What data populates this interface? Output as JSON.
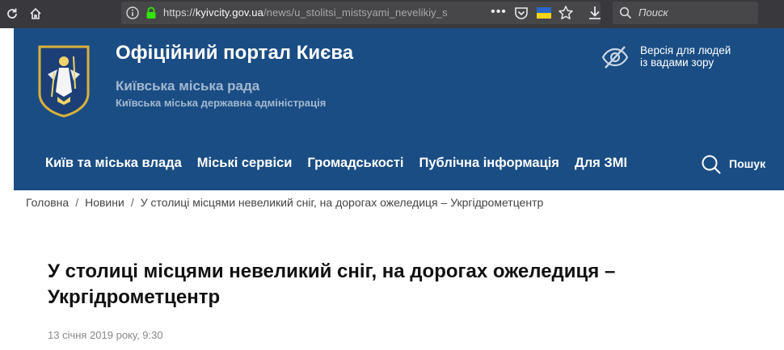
{
  "browser": {
    "url_host": "kyivcity.gov.ua",
    "url_prefix": "https://",
    "url_path": "/news/u_stolitsi_mistsyami_nevelikiy_s",
    "search_placeholder": "Поиск",
    "more_label": "•••",
    "icons": [
      "reload-icon",
      "home-icon",
      "info-icon",
      "lock-icon",
      "page-actions-icon",
      "pocket-icon",
      "flag-icon",
      "bookmark-star-icon",
      "download-icon",
      "search-icon"
    ]
  },
  "header": {
    "title": "Офіційний портал Києва",
    "subtitle1": "Київська міська рада",
    "subtitle2": "Київська міська державна адміністрація",
    "accessibility_line1": "Версія для людей",
    "accessibility_line2": "із вадами зору",
    "bg_color": "#1a4d84"
  },
  "nav": {
    "items": [
      {
        "label": "Київ та міська влада"
      },
      {
        "label": "Міські сервіси"
      },
      {
        "label": "Громадськості"
      },
      {
        "label": "Публічна інформація"
      },
      {
        "label": "Для ЗМІ"
      }
    ],
    "search_label": "Пошук"
  },
  "breadcrumb": {
    "home": "Головна",
    "news": "Новини",
    "current": "У столиці місцями невеликий сніг, на дорогах ожеледиця – Укргідрометцентр",
    "separator": "/"
  },
  "article": {
    "title": "У столиці місцями невеликий сніг, на дорогах ожеледиця – Укргідрометцентр",
    "date": "13 січня 2019 року, 9:30"
  }
}
